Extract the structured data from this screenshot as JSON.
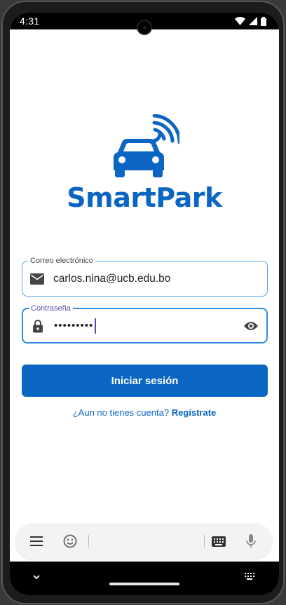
{
  "status_bar": {
    "time": "4:31"
  },
  "brand": {
    "name": "SmartPark",
    "color": "#0a66c2"
  },
  "email_field": {
    "label": "Correo electrónico",
    "value": "carlos.nina@ucb.edu.bo",
    "icon": "mail-icon"
  },
  "password_field": {
    "label": "Contraseña",
    "masked_value": "•••••••••",
    "icon": "lock-icon",
    "toggle_icon": "eye-icon"
  },
  "login_button": {
    "label": "Iniciar sesión"
  },
  "register": {
    "prompt": "¿Aun no tienes cuenta?",
    "link": "Regístrate"
  },
  "keyboard_toolbar": {
    "icons": [
      "menu-icon",
      "emoji-icon",
      "keyboard-icon",
      "mic-icon"
    ]
  },
  "colors": {
    "accent": "#0a66c2",
    "focus": "#2f8ee0",
    "cursor": "#5b4ca8"
  }
}
